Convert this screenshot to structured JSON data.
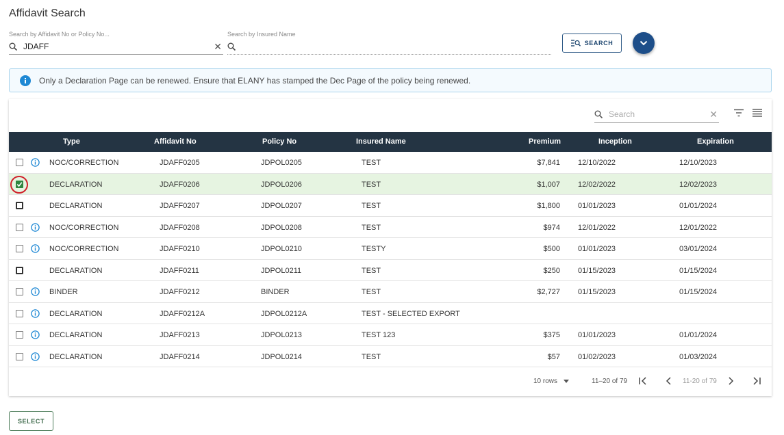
{
  "page": {
    "title": "Affidavit Search"
  },
  "search": {
    "affidavit_label": "Search by Affidavit No or Policy No...",
    "affidavit_value": "JDAFF",
    "insured_label": "Search by Insured Name",
    "insured_value": "",
    "search_button": "SEARCH"
  },
  "banner": {
    "text": "Only a Declaration Page can be renewed. Ensure that ELANY has stamped the Dec Page of the policy being renewed."
  },
  "table": {
    "search_placeholder": "Search",
    "columns": {
      "type": "Type",
      "affidavit_no": "Affidavit No",
      "policy_no": "Policy No",
      "insured_name": "Insured Name",
      "premium": "Premium",
      "inception": "Inception",
      "expiration": "Expiration"
    },
    "rows": [
      {
        "info": true,
        "checked": false,
        "type": "NOC/CORRECTION",
        "affidavit_no": "JDAFF0205",
        "policy_no": "JDPOL0205",
        "insured_name": "TEST",
        "premium": "$7,841",
        "inception": "12/10/2022",
        "expiration": "12/10/2023"
      },
      {
        "info": false,
        "checked": true,
        "type": "DECLARATION",
        "affidavit_no": "JDAFF0206",
        "policy_no": "JDPOL0206",
        "insured_name": "TEST",
        "premium": "$1,007",
        "inception": "12/02/2022",
        "expiration": "12/02/2023"
      },
      {
        "info": false,
        "checked": false,
        "type": "DECLARATION",
        "affidavit_no": "JDAFF0207",
        "policy_no": "JDPOL0207",
        "insured_name": "TEST",
        "premium": "$1,800",
        "inception": "01/01/2023",
        "expiration": "01/01/2024"
      },
      {
        "info": true,
        "checked": false,
        "type": "NOC/CORRECTION",
        "affidavit_no": "JDAFF0208",
        "policy_no": "JDPOL0208",
        "insured_name": "TEST",
        "premium": "$974",
        "inception": "12/01/2022",
        "expiration": "12/01/2022"
      },
      {
        "info": true,
        "checked": false,
        "type": "NOC/CORRECTION",
        "affidavit_no": "JDAFF0210",
        "policy_no": "JDPOL0210",
        "insured_name": "TESTY",
        "premium": "$500",
        "inception": "01/01/2023",
        "expiration": "03/01/2024"
      },
      {
        "info": false,
        "checked": false,
        "type": "DECLARATION",
        "affidavit_no": "JDAFF0211",
        "policy_no": "JDPOL0211",
        "insured_name": "TEST",
        "premium": "$250",
        "inception": "01/15/2023",
        "expiration": "01/15/2024"
      },
      {
        "info": true,
        "checked": false,
        "type": "BINDER",
        "affidavit_no": "JDAFF0212",
        "policy_no": "BINDER",
        "insured_name": "TEST",
        "premium": "$2,727",
        "inception": "01/15/2023",
        "expiration": "01/15/2024"
      },
      {
        "info": true,
        "checked": false,
        "type": "DECLARATION",
        "affidavit_no": "JDAFF0212A",
        "policy_no": "JDPOL0212A",
        "insured_name": "TEST - SELECTED EXPORT",
        "premium": "",
        "inception": "",
        "expiration": ""
      },
      {
        "info": true,
        "checked": false,
        "type": "DECLARATION",
        "affidavit_no": "JDAFF0213",
        "policy_no": "JDPOL0213",
        "insured_name": "TEST 123",
        "premium": "$375",
        "inception": "01/01/2023",
        "expiration": "01/01/2024"
      },
      {
        "info": true,
        "checked": false,
        "type": "DECLARATION",
        "affidavit_no": "JDAFF0214",
        "policy_no": "JDPOL0214",
        "insured_name": "TEST",
        "premium": "$57",
        "inception": "01/02/2023",
        "expiration": "01/03/2024"
      }
    ]
  },
  "pagination": {
    "rows_per_page": "10 rows",
    "range": "11–20 of 79",
    "range_secondary": "11-20 of 79"
  },
  "footer": {
    "select_button": "SELECT"
  },
  "colors": {
    "header_bg": "#243443",
    "selected_row": "#e6f4e1",
    "accent_blue": "#1d4e89",
    "info_blue": "#1e88d4",
    "check_green": "#2e8540"
  }
}
